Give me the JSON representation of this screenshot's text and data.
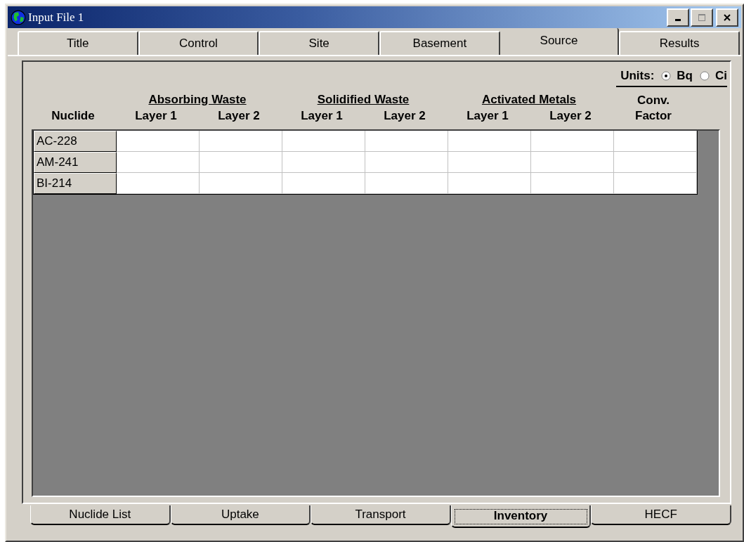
{
  "window": {
    "title": "Input File 1"
  },
  "tabs": [
    {
      "label": "Title",
      "selected": false
    },
    {
      "label": "Control",
      "selected": false
    },
    {
      "label": "Site",
      "selected": false
    },
    {
      "label": "Basement",
      "selected": false
    },
    {
      "label": "Source",
      "selected": true
    },
    {
      "label": "Results",
      "selected": false
    }
  ],
  "units": {
    "label": "Units:",
    "options": [
      {
        "label": "Bq",
        "selected": true
      },
      {
        "label": "Ci",
        "selected": false
      }
    ]
  },
  "table": {
    "row_header": "Nuclide",
    "groups": [
      {
        "label": "Absorbing Waste",
        "columns": [
          "Layer 1",
          "Layer 2"
        ]
      },
      {
        "label": "Solidified Waste",
        "columns": [
          "Layer 1",
          "Layer 2"
        ]
      },
      {
        "label": "Activated Metals",
        "columns": [
          "Layer 1",
          "Layer 2"
        ]
      }
    ],
    "extra_column": {
      "lines": [
        "Conv.",
        "Factor"
      ]
    },
    "rows": [
      {
        "nuclide": "AC-228"
      },
      {
        "nuclide": "AM-241"
      },
      {
        "nuclide": "BI-214"
      }
    ]
  },
  "bottom_tabs": [
    {
      "label": "Nuclide List",
      "selected": false
    },
    {
      "label": "Uptake",
      "selected": false
    },
    {
      "label": "Transport",
      "selected": false
    },
    {
      "label": "Inventory",
      "selected": true
    },
    {
      "label": "HECF",
      "selected": false
    }
  ]
}
